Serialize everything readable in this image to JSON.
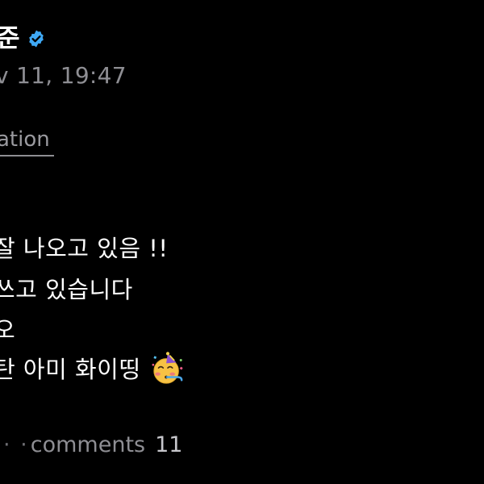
{
  "post": {
    "author": "준",
    "verified_color": "#3fa9f5",
    "verified_icon": "verified-badge-icon",
    "timestamp": "v 11, 19:47",
    "translation_label": "ation",
    "body_lines": [
      "잘 나오고 있음 !!",
      "쓰고 있습니다",
      "오",
      "탄 아미 화이띵"
    ],
    "emoji": "partying-face-icon"
  },
  "footer": {
    "dots": "· ·",
    "comments_label": "comments",
    "comments_count": "11"
  }
}
